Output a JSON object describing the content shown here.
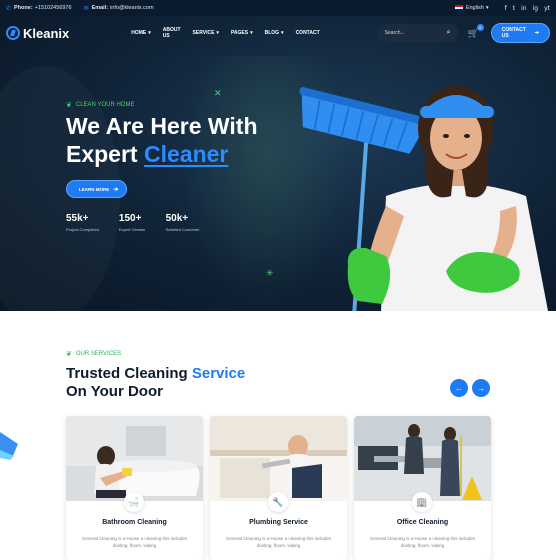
{
  "topbar": {
    "phone_label": "Phone:",
    "phone_value": "+15102456976",
    "email_label": "Email:",
    "email_value": "info@kleanix.com",
    "language": "English",
    "social": [
      "f",
      "t",
      "in",
      "ig",
      "yt"
    ]
  },
  "nav": {
    "logo": "Kleanix",
    "items": [
      {
        "label": "HOME",
        "has_caret": true
      },
      {
        "label": "ABOUT US",
        "has_caret": false
      },
      {
        "label": "SERVICE",
        "has_caret": true
      },
      {
        "label": "PAGES",
        "has_caret": true
      },
      {
        "label": "BLOG",
        "has_caret": true
      },
      {
        "label": "CONTACT",
        "has_caret": false
      }
    ],
    "search_placeholder": "Search...",
    "cart_count": "0",
    "contact_button": "CONTACT US"
  },
  "hero": {
    "tagline": "CLEAN YOUR HOME",
    "headline_line1": "We Are Here With",
    "headline_line2_plain": "Expert ",
    "headline_line2_accent": "Cleaner",
    "learn_button": "LEARN MORE",
    "stats": [
      {
        "value": "55k+",
        "label": "Project Completed"
      },
      {
        "value": "150+",
        "label": "Expert Cleaner"
      },
      {
        "value": "50k+",
        "label": "Satisfied Customer"
      }
    ]
  },
  "services": {
    "tag": "OUR SERVICES",
    "title_plain": "Trusted Cleaning ",
    "title_accent": "Service",
    "title_line2": "On Your Door",
    "cards": [
      {
        "title": "Bathroom Cleaning",
        "text": "General Cleaning is a House a cleaning this includes dusting, floors, wiping",
        "icon": "bathtub-icon"
      },
      {
        "title": "Plumbing Service",
        "text": "General Cleaning is a House a cleaning this includes dusting, floors, wiping",
        "icon": "wrench-icon"
      },
      {
        "title": "Office Cleaning",
        "text": "General Cleaning is a House a cleaning this includes dusting, floors, wiping",
        "icon": "building-icon"
      }
    ]
  },
  "colors": {
    "brand_blue": "#1e7bf2",
    "accent_green": "#40d96a",
    "dark_navy": "#0b1b2e"
  }
}
